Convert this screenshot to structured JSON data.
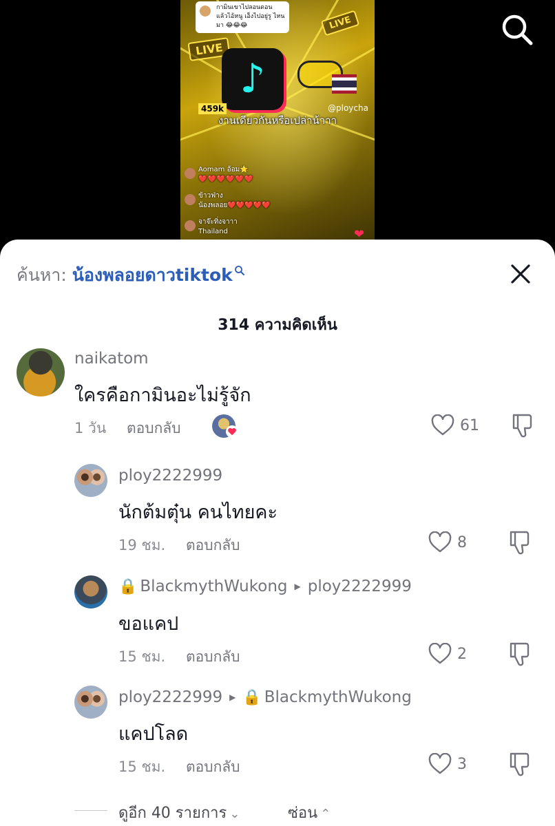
{
  "video": {
    "caption_bubble": "กามินเขาไปลอนดอน แล้วไอ้หนู เอ็งไปอยู่รู ไหนมา 😂😂😂",
    "live_sign": "LIVE",
    "live_sign_2": "LIVE",
    "viewer_count": "459k",
    "handle_overlay": "@ploycha",
    "video_caption": "งานเดียวกันหรือเปล่าน้าาา",
    "chat": [
      {
        "name": "Aomam อ้อม🌟",
        "message": "❤️❤️❤️❤️❤️❤️"
      },
      {
        "name": "ข้าวฟ่าง",
        "message": "น้องพลอย❤️❤️❤️❤️❤️"
      },
      {
        "name": "จาจ๊ะทิ่งจาาา",
        "message": "Thailand"
      }
    ]
  },
  "search": {
    "prefix": "ค้นหา:",
    "term": "น้องพลอยดาวtiktok"
  },
  "comments_header": "314 ความคิดเห็น",
  "comments": [
    {
      "user": "naikatom",
      "text": "ใครคือกามินอะไม่รู้จัก",
      "time": "1 วัน",
      "reply": "ตอบกลับ",
      "likes": "61"
    },
    {
      "user": "ploy2222999",
      "text": "นักต้มตุ๋น คนไทยคะ",
      "time": "19 ชม.",
      "reply": "ตอบกลับ",
      "likes": "8"
    },
    {
      "user": "BlackmythWukong",
      "reply_to": "ploy2222999",
      "text": "ขอแคป",
      "time": "15 ชม.",
      "reply": "ตอบกลับ",
      "likes": "2"
    },
    {
      "user": "ploy2222999",
      "reply_to": "BlackmythWukong",
      "text": "แคปโลด",
      "time": "15 ชม.",
      "reply": "ตอบกลับ",
      "likes": "3"
    }
  ],
  "footer": {
    "more": "ดูอีก 40 รายการ",
    "hide": "ซ่อน"
  },
  "colors": {
    "search_term": "#2b5db9",
    "like_heart": "#fe2c55"
  }
}
